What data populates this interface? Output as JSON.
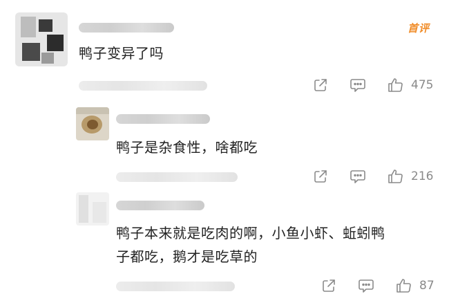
{
  "comments": [
    {
      "text": "鸭子变异了吗",
      "badge": "首评",
      "likes": "475"
    },
    {
      "text": "鸭子是杂食性，啥都吃",
      "likes": "216"
    },
    {
      "text_line1": "鸭子本来就是吃肉的啊，小鱼小虾、蚯蚓鸭",
      "text_line2": "子都吃，鹅才是吃草的",
      "likes": "87"
    }
  ],
  "icons": {
    "share": "share-icon",
    "reply": "comment-icon",
    "like": "thumbs-up-icon"
  },
  "colors": {
    "badge": "#f08c28",
    "action_icons": "#8a8a8a"
  }
}
